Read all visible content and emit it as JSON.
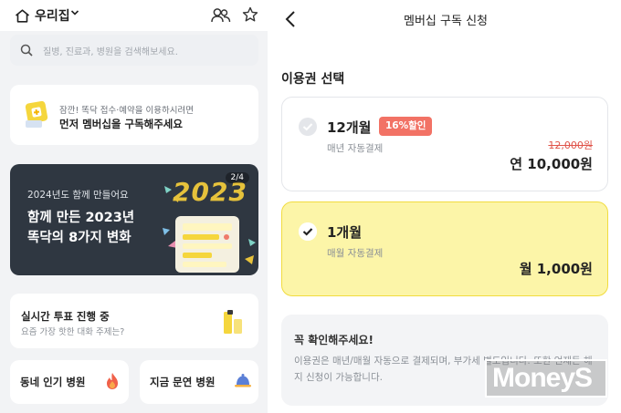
{
  "colors": {
    "brand_yellow": "#fcf5a8",
    "accent_yellow": "#f1dc3f",
    "discount_red": "#f27265",
    "banner_dark": "#2f3741"
  },
  "left": {
    "location_label": "우리집",
    "icons": [
      "home-icon",
      "chevron-down-icon",
      "people-icon",
      "star-icon",
      "search-icon"
    ],
    "search_placeholder": "질병, 진료과, 병원을 검색해보세요.",
    "promo": {
      "line1": "잠깐! 똑닥 접수·예약을 이용하시려면",
      "line2": "먼저 멤버십을 구독해주세요"
    },
    "banner": {
      "subtitle": "2024년도 함께 만들어요",
      "title_line1": "함께 만든 2023년",
      "title_line2": "똑닥의 8가지 변화",
      "year_art": "2023",
      "page_indicator": "2/4"
    },
    "vote": {
      "title": "실시간 투표 진행 중",
      "subtitle": "요즘 가장 핫한 대화 주제는?"
    },
    "shortcuts": [
      {
        "label": "동네 인기 병원",
        "icon": "fire-icon"
      },
      {
        "label": "지금 문연 병원",
        "icon": "bell-icon"
      }
    ]
  },
  "right": {
    "title": "멤버십 구독 신청",
    "section_title": "이용권 선택",
    "plans": [
      {
        "name": "12개월",
        "badge": "16%할인",
        "desc": "매년 자동결제",
        "old_price": "12,000원",
        "price": "연 10,000원",
        "selected": false
      },
      {
        "name": "1개월",
        "desc": "매월 자동결제",
        "price": "월 1,000원",
        "selected": true
      }
    ],
    "notice": {
      "title": "꼭 확인해주세요!",
      "body": "이용권은 매년/매월 자동으로 결제되며, 부가세 별도입니다. 또한 언제든 해지 신청이 가능합니다."
    }
  },
  "watermark": "MoneyS"
}
